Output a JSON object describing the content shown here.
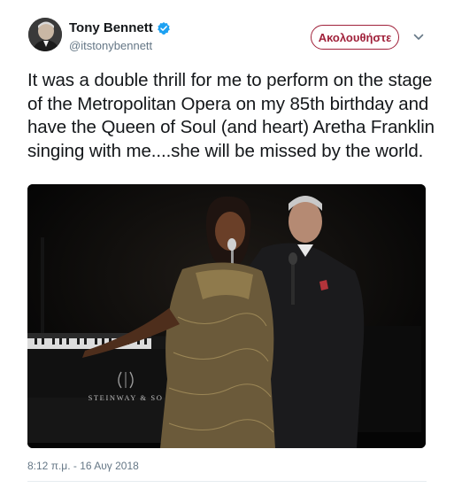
{
  "user": {
    "name": "Tony Bennett",
    "handle": "@itstonybennett",
    "verified": true
  },
  "follow_button": {
    "label": "Ακολουθήστε"
  },
  "tweet": {
    "text": "It was a double thrill for me to perform on the stage of the Metropolitan Opera on my 85th birthday and have the Queen of Soul (and heart) Aretha Franklin singing with me....she will be missed by the world.",
    "timestamp": "8:12 π.μ. - 16 Αυγ 2018"
  },
  "photo": {
    "piano_brand": "STEINWAY & SO"
  },
  "icons": {
    "verified": "verified-badge-icon",
    "menu": "chevron-down-icon"
  },
  "colors": {
    "accent": "#a0213a",
    "verified": "#1da1f2",
    "secondary_text": "#657786"
  }
}
